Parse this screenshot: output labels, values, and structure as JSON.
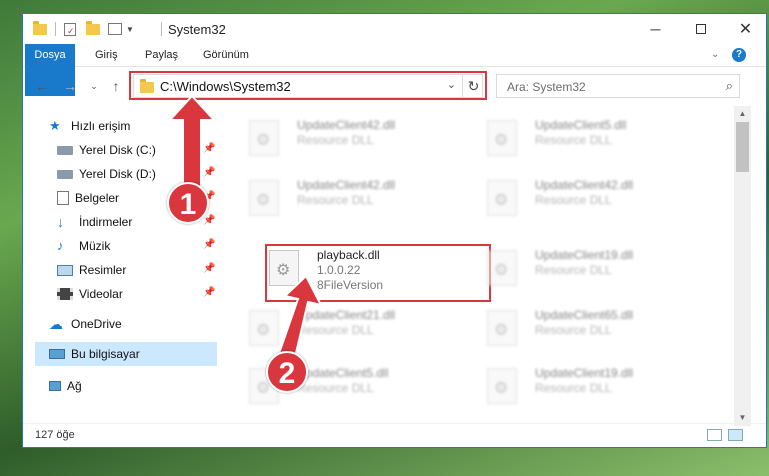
{
  "window": {
    "title": "System32"
  },
  "ribbon": {
    "tabs": [
      "Dosya",
      "Giriş",
      "Paylaş",
      "Görünüm"
    ]
  },
  "address": {
    "path": "C:\\Windows\\System32",
    "search_placeholder": "Ara: System32"
  },
  "nav": {
    "items": [
      {
        "label": "Hızlı erişim",
        "pinned": false
      },
      {
        "label": "Yerel Disk (C:)",
        "pinned": true
      },
      {
        "label": "Yerel Disk (D:)",
        "pinned": true
      },
      {
        "label": "Belgeler",
        "pinned": true
      },
      {
        "label": "İndirmeler",
        "pinned": true
      },
      {
        "label": "Müzik",
        "pinned": true
      },
      {
        "label": "Resimler",
        "pinned": true
      },
      {
        "label": "Videolar",
        "pinned": true
      },
      {
        "label": "OneDrive",
        "pinned": false
      },
      {
        "label": "Bu bilgisayar",
        "pinned": false
      },
      {
        "label": "Ağ",
        "pinned": false
      }
    ]
  },
  "files": [
    {
      "name": "UpdateClient42.dll",
      "sub": "Resource DLL"
    },
    {
      "name": "UpdateClient5.dll",
      "sub": "Resource DLL"
    },
    {
      "name": "UpdateClient42.dll",
      "sub": "Resource DLL"
    },
    {
      "name": "UpdateClient42.dll",
      "sub": "Resource DLL"
    },
    {
      "name": "playback.dll",
      "sub": "1.0.0.22",
      "sub2": "8FileVersion"
    },
    {
      "name": "UpdateClient19.dll",
      "sub": "Resource DLL"
    },
    {
      "name": "UpdateClient21.dll",
      "sub": "Resource DLL"
    },
    {
      "name": "UpdateClient65.dll",
      "sub": "Resource DLL"
    },
    {
      "name": "UpdateClient5.dll",
      "sub": "Resource DLL"
    },
    {
      "name": "UpdateClient19.dll",
      "sub": "Resource DLL"
    }
  ],
  "status": {
    "count": "127 öğe"
  },
  "annotations": {
    "one": "1",
    "two": "2"
  },
  "colors": {
    "accent": "#1979ca",
    "highlight": "#d9363e",
    "selected": "#cce8ff"
  }
}
